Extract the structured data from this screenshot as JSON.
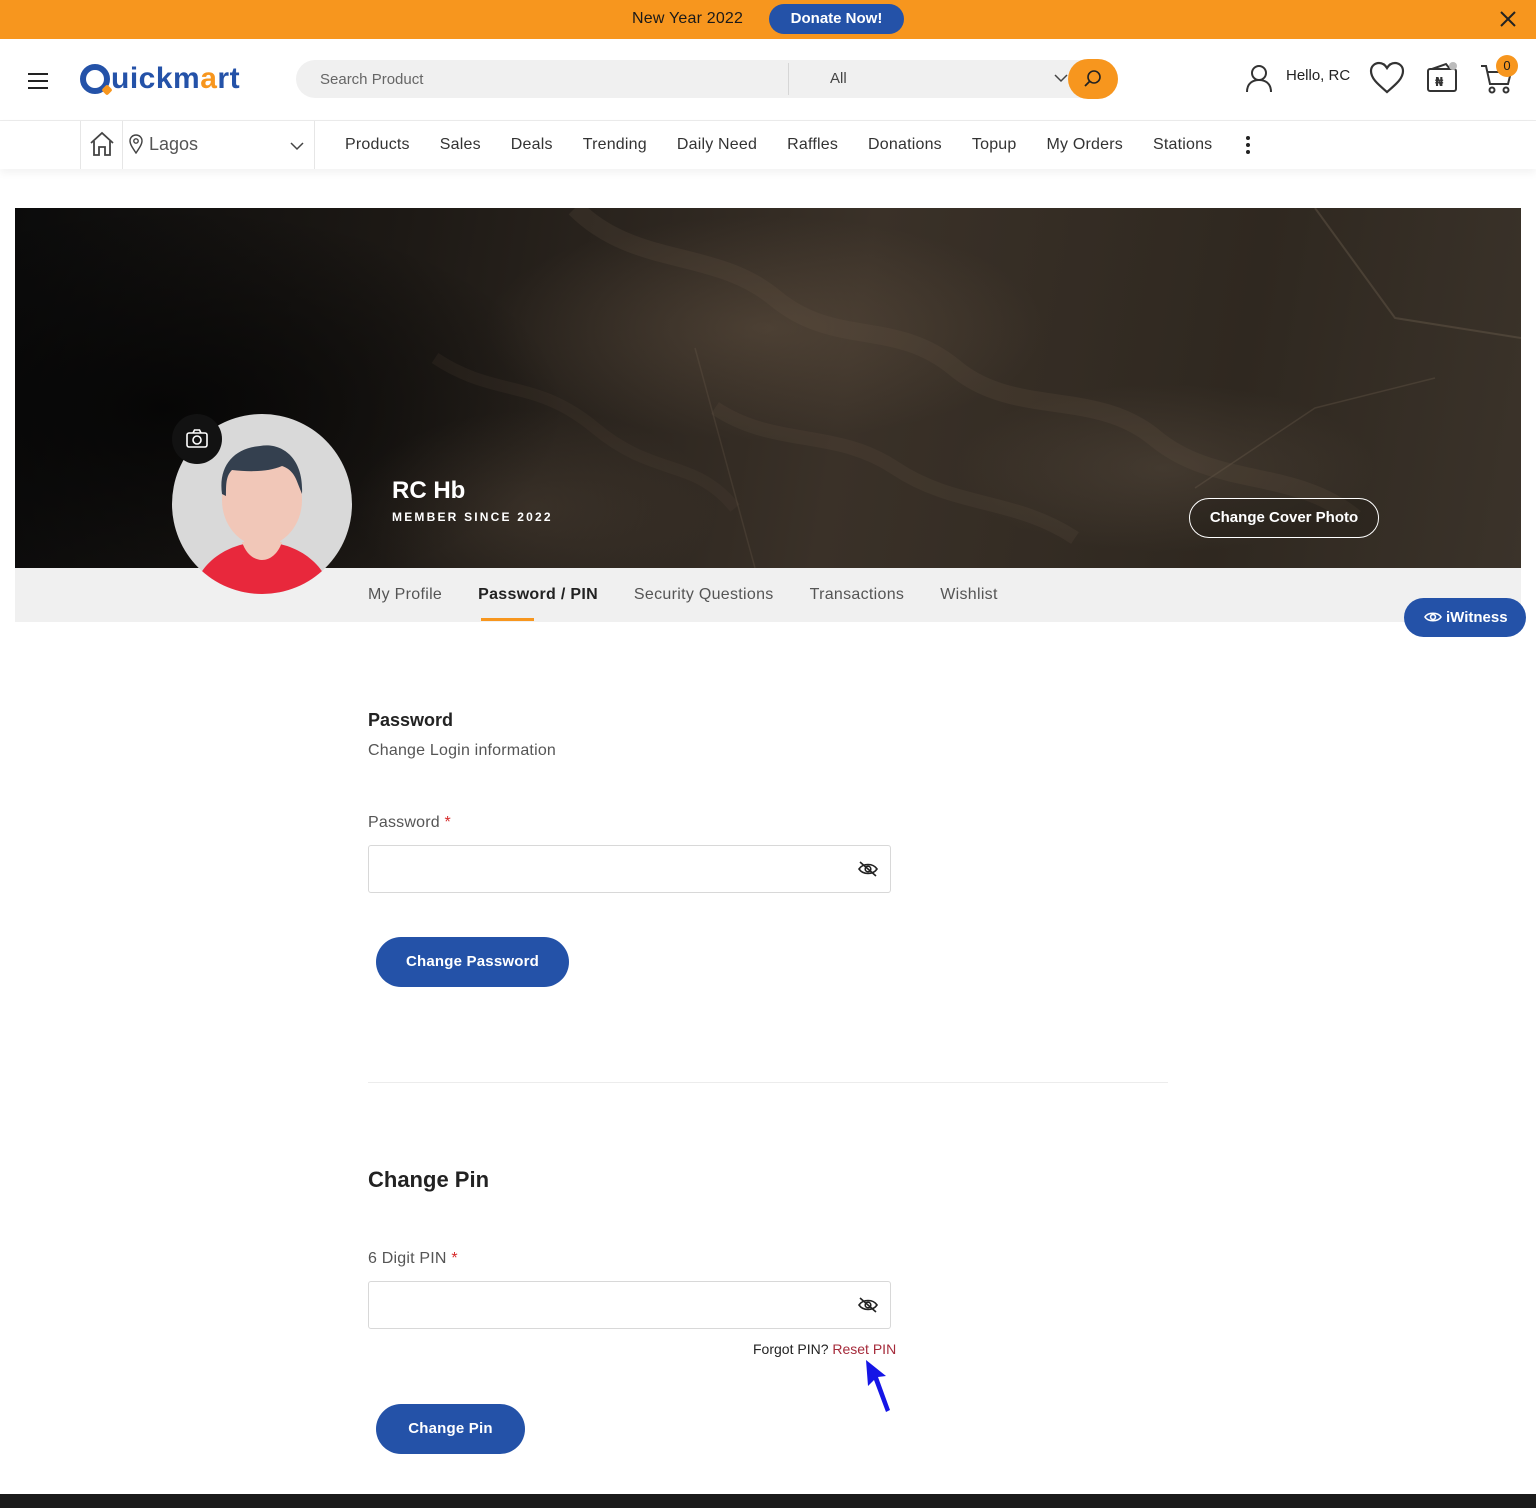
{
  "promo": {
    "text": "New Year 2022",
    "button_label": "Donate Now!"
  },
  "header": {
    "logo": {
      "first": "Q",
      "rest_a": "uickm",
      "rest_o": "a",
      "rest_b": "rt"
    },
    "search": {
      "placeholder": "Search Product",
      "category": "All"
    },
    "greeting": "Hello, RC",
    "cart_count": "0"
  },
  "nav": {
    "location": "Lagos",
    "items": [
      "Products",
      "Sales",
      "Deals",
      "Trending",
      "Daily Need",
      "Raffles",
      "Donations",
      "Topup",
      "My Orders",
      "Stations"
    ]
  },
  "profile": {
    "name": "RC Hb",
    "member_since": "MEMBER SINCE 2022",
    "cover_button": "Change Cover Photo"
  },
  "tabs": [
    {
      "label": "My Profile",
      "active": false
    },
    {
      "label": "Password / PIN",
      "active": true
    },
    {
      "label": "Security Questions",
      "active": false
    },
    {
      "label": "Transactions",
      "active": false
    },
    {
      "label": "Wishlist",
      "active": false
    }
  ],
  "iwitness_label": "iWitness",
  "password_section": {
    "title": "Password",
    "subtitle": "Change Login information",
    "field_label": "Password",
    "required_mark": "*",
    "value": "",
    "button": "Change Password"
  },
  "pin_section": {
    "title": "Change Pin",
    "field_label": "6 Digit PIN",
    "required_mark": "*",
    "value": "",
    "forgot_text": "Forgot PIN?",
    "reset_link": "Reset PIN",
    "button": "Change Pin"
  },
  "colors": {
    "accent_orange": "#f7961e",
    "brand_blue": "#2452a8",
    "reset_link": "#a52a3a",
    "avatar_shirt": "#e8283c"
  },
  "icons": [
    "close-icon",
    "hamburger-icon",
    "search-icon",
    "chevron-down-icon",
    "user-icon",
    "heart-icon",
    "wallet-icon",
    "cart-icon",
    "home-icon",
    "location-pin-icon",
    "more-vertical-icon",
    "camera-icon",
    "eye-icon",
    "eye-off-icon",
    "cursor-arrow-icon"
  ]
}
